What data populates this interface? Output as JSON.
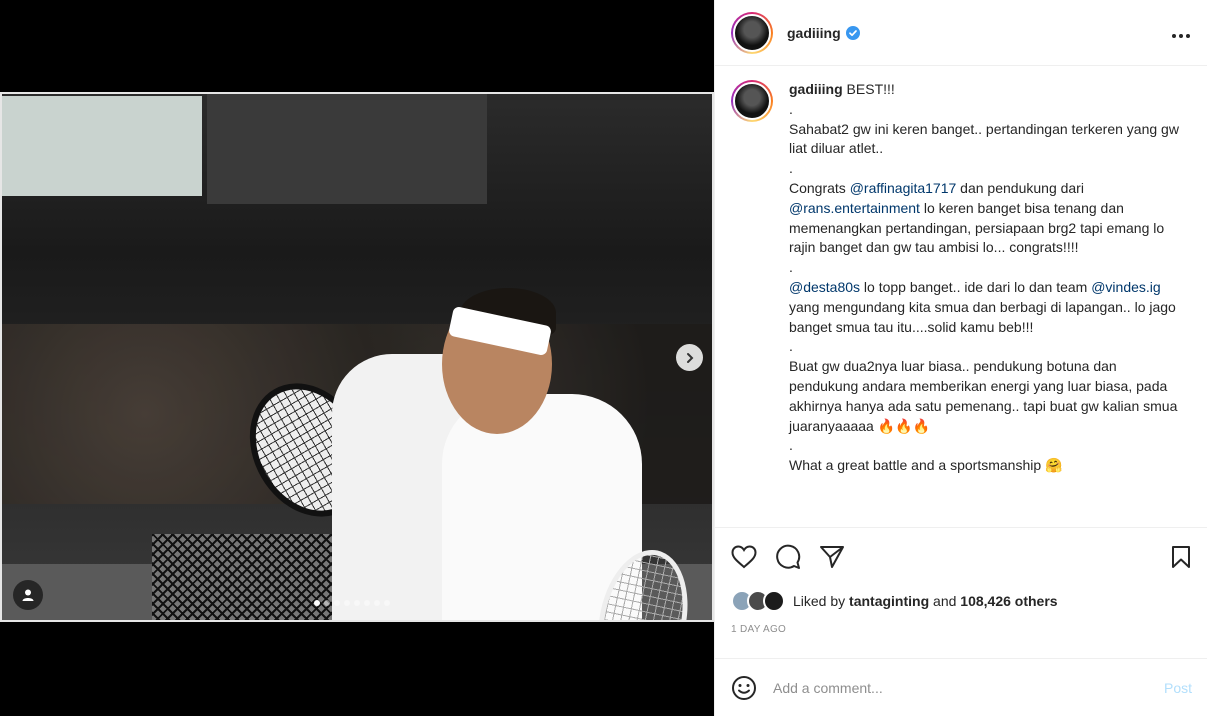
{
  "post": {
    "username": "gadiiing",
    "more_icon": "more-horizontal-icon",
    "caption_lines": [
      {
        "parts": [
          {
            "u": "gadiiing"
          },
          {
            "t": " BEST!!!"
          }
        ]
      },
      {
        "parts": [
          {
            "t": "."
          }
        ]
      },
      {
        "parts": [
          {
            "t": "Sahabat2 gw ini keren banget.. pertandingan terkeren yang gw liat diluar atlet.."
          }
        ]
      },
      {
        "parts": [
          {
            "t": "."
          }
        ]
      },
      {
        "parts": [
          {
            "t": "Congrats "
          },
          {
            "m": "@raffinagita1717"
          },
          {
            "t": " dan pendukung dari "
          },
          {
            "m": "@rans.entertainment"
          },
          {
            "t": " lo keren banget bisa tenang dan memenangkan pertandingan, persiapaan brg2 tapi emang lo rajin banget dan gw tau ambisi lo... congrats!!!!"
          }
        ]
      },
      {
        "parts": [
          {
            "t": "."
          }
        ]
      },
      {
        "parts": [
          {
            "m": "@desta80s"
          },
          {
            "t": " lo topp banget.. ide dari lo dan team "
          },
          {
            "m": "@vindes.ig"
          },
          {
            "t": " yang mengundang kita smua dan berbagi di lapangan.. lo jago banget smua tau itu....solid kamu beb!!!"
          }
        ]
      },
      {
        "parts": [
          {
            "t": "."
          }
        ]
      },
      {
        "parts": [
          {
            "t": "Buat gw dua2nya luar biasa.. pendukung botuna dan pendukung andara memberikan energi yang luar biasa, pada akhirnya hanya ada satu pemenang.. tapi buat gw kalian smua juaranyaaaaa 🔥🔥🔥"
          }
        ]
      },
      {
        "parts": [
          {
            "t": "."
          }
        ]
      },
      {
        "parts": [
          {
            "t": "What a great battle and a sportsmanship 🤗"
          }
        ]
      }
    ],
    "liked_by_prefix": "Liked by ",
    "liked_by_user": "tantaginting",
    "liked_by_suffix": " and ",
    "likes_others": "108,426 others",
    "time_ago": "1 DAY AGO",
    "comment_placeholder": "Add a comment...",
    "post_label": "Post",
    "colors": {
      "verified": "#3897f0",
      "mention": "#00376b",
      "post_button": "#b2dffc"
    }
  },
  "carousel": {
    "total_slides": 8,
    "active_slide": 1
  }
}
